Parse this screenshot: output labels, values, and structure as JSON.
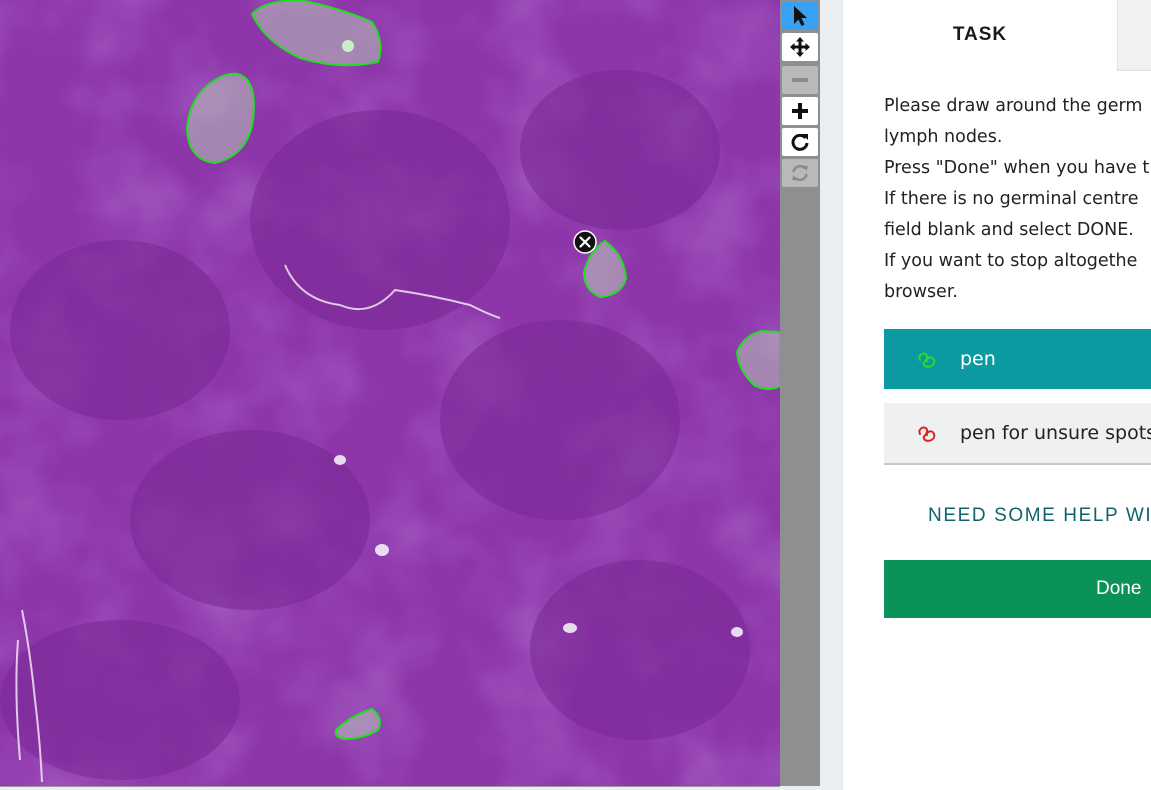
{
  "viewer": {
    "toolbar": {
      "tools": [
        {
          "name": "select",
          "icon": "arrow-pointer-icon",
          "state": "active"
        },
        {
          "name": "pan",
          "icon": "move-arrows-icon",
          "state": "enabled"
        },
        {
          "name": "zoom-out",
          "icon": "minus-icon",
          "state": "disabled"
        },
        {
          "name": "zoom-in",
          "icon": "plus-icon",
          "state": "enabled"
        },
        {
          "name": "rotate",
          "icon": "rotate-icon",
          "state": "enabled"
        },
        {
          "name": "reset",
          "icon": "refresh-icon",
          "state": "disabled"
        }
      ]
    },
    "annotation_color": "#22dd22",
    "delete_icon": "close-circle-icon"
  },
  "panel": {
    "tabs": {
      "task_label": "TASK"
    },
    "instructions": [
      "Please draw around the germ",
      "lymph nodes.",
      "Press \"Done\" when you have t",
      "If there is no germinal centre",
      "field blank and select DONE.",
      "If you want to stop altogethe",
      "browser."
    ],
    "choices": [
      {
        "label": "pen",
        "icon": "pen-scribble-icon",
        "icon_color": "#2bd92b",
        "selected": true
      },
      {
        "label": "pen for unsure spots",
        "icon": "pen-scribble-icon",
        "icon_color": "#e02020",
        "selected": false
      }
    ],
    "help_link": "NEED SOME HELP WI",
    "done_button": "Done",
    "colors": {
      "accent_teal": "#0b9aa0",
      "done_green": "#0b9258",
      "help_text": "#12626c"
    }
  }
}
